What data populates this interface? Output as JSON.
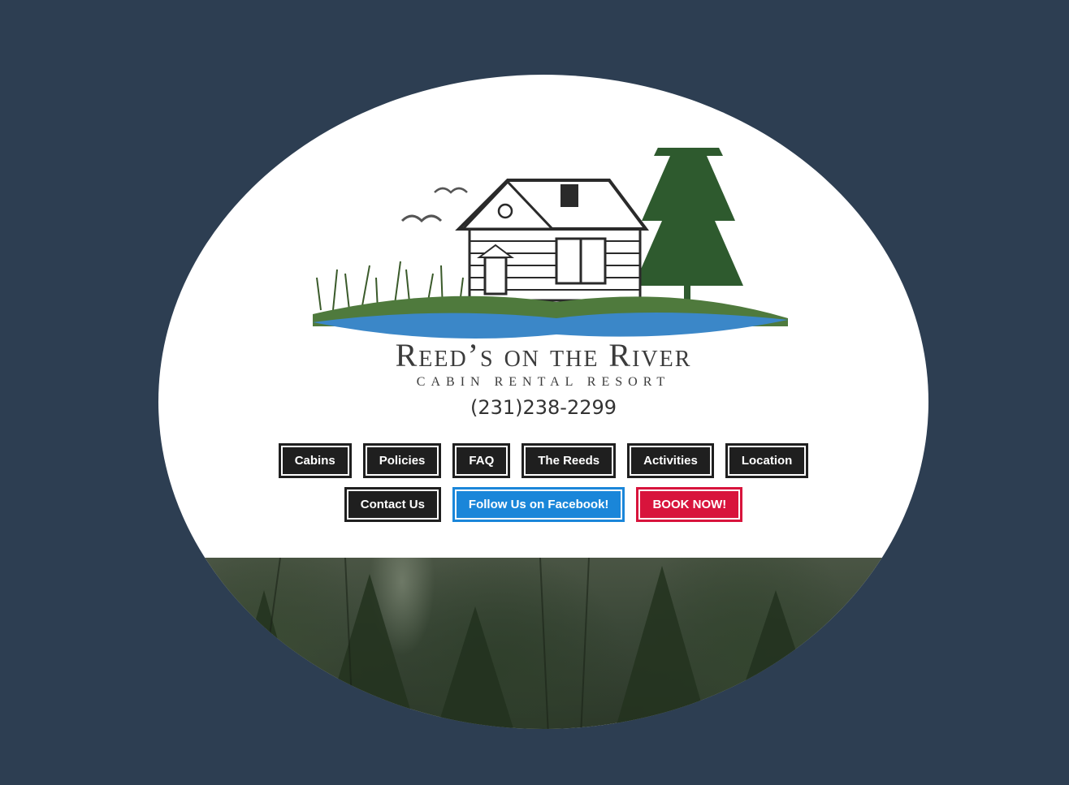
{
  "brand": {
    "title": "Reed’s on the River",
    "subtitle": "CABIN RENTAL RESORT",
    "phone": "(231)238-2299"
  },
  "nav": {
    "row1": [
      "Cabins",
      "Policies",
      "FAQ",
      "The Reeds",
      "Activities",
      "Location"
    ],
    "row2": [
      "Contact Us",
      "Follow Us on Facebook!",
      "BOOK NOW!"
    ]
  },
  "colors": {
    "background": "#2d3e52",
    "nav_dark": "#1f1f1f",
    "facebook_blue": "#1a86d9",
    "book_red": "#d8143c"
  },
  "icons": {
    "logo": "cabin-river-logo-icon"
  }
}
